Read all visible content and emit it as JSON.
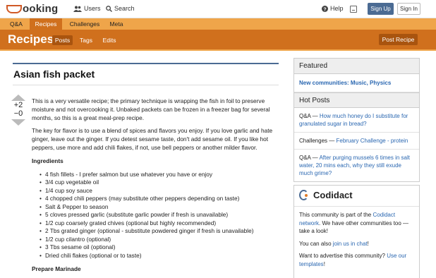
{
  "topbar": {
    "logo_text": "ooking",
    "nav_users": "Users",
    "nav_search": "Search",
    "nav_help": "Help",
    "signup": "Sign Up",
    "signin": "Sign In"
  },
  "category_tabs": [
    {
      "label": "Q&A"
    },
    {
      "label": "Recipes"
    },
    {
      "label": "Challenges"
    },
    {
      "label": "Meta"
    }
  ],
  "category": {
    "title": "Recipes",
    "subtabs": [
      {
        "label": "Posts"
      },
      {
        "label": "Tags"
      },
      {
        "label": "Edits"
      }
    ],
    "post_button": "Post Recipe"
  },
  "post": {
    "title": "Asian fish packet",
    "votes_up": "+2",
    "votes_down": "−0",
    "para1": "This is a very versatile recipe; the primary technique is wrapping the fish in foil to preserve moisture and not overcooking it. Unbaked packets can be frozen in a freezer bag for several months, so this is a great meal-prep recipe.",
    "para2": "The key for flavor is to use a blend of spices and flavors you enjoy. If you love garlic and hate ginger, leave out the ginger. If you detest sesame taste, don't add sesame oil. If you like hot peppers, use more and add chili flakes, if not, use bell peppers or another milder flavor.",
    "ingredients_heading": "Ingredients",
    "ingredients": [
      "4 fish fillets - I prefer salmon but use whatever you have or enjoy",
      "3/4 cup vegetable oil",
      "1/4 cup soy sauce",
      "4 chopped chili peppers (may substitute other peppers depending on taste)",
      "Salt & Pepper to season",
      "5 cloves pressed garlic (substitute garlic powder if fresh is unavailable)",
      "1/2 cup coarsely grated chives (optional but highly recommended)",
      "2 Tbs grated ginger (optional - substitute powdered ginger if fresh is unavailable)",
      "1/2 cup cilantro (optional)",
      "3 Tbs sesame oil (optional)",
      "Dried chili flakes (optional or to taste)"
    ],
    "next_heading": "Prepare Marinade"
  },
  "sidebar": {
    "featured_title": "Featured",
    "featured_link": "New communities: Music, Physics",
    "hot_title": "Hot Posts",
    "hot_posts": [
      {
        "category": "Q&A",
        "sep": " — ",
        "title": "How much honey do I substitute for granulated sugar in bread?"
      },
      {
        "category": "Challenges",
        "sep": " — ",
        "title": "February Challenge - protein"
      },
      {
        "category": "Q&A",
        "sep": " — ",
        "title": "After purging mussels 6 times in salt water, 20 mins each, why they still exude much grime?"
      }
    ],
    "codidact_name": "Codidact",
    "about_pre": "This community is part of the ",
    "about_link": "Codidact network",
    "about_post": ". We have other communities too — take a look!",
    "chat_pre": "You can also ",
    "chat_link": "join us in chat",
    "chat_post": "!",
    "advertise_pre": "Want to advertise this community? ",
    "advertise_link": "Use our templates",
    "advertise_post": "!"
  }
}
